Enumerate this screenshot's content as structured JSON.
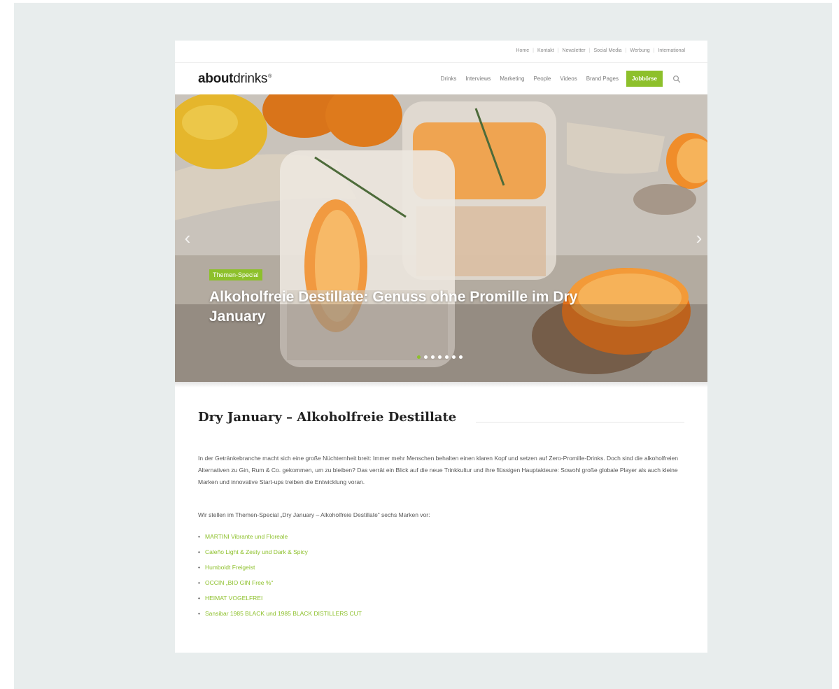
{
  "colors": {
    "accent": "#8dc02b",
    "page_bg": "#e8eded",
    "text": "#555555"
  },
  "toplinks": [
    "Home",
    "Kontakt",
    "Newsletter",
    "Social Media",
    "Werbung",
    "International"
  ],
  "logo": {
    "bold": "about",
    "light": "drinks",
    "mark": "®"
  },
  "nav": {
    "items": [
      "Drinks",
      "Interviews",
      "Marketing",
      "People",
      "Videos",
      "Brand Pages"
    ],
    "cta": "Jobbörse",
    "search_icon": "search-icon"
  },
  "hero": {
    "badge": "Themen-Special",
    "title": "Alkoholfreie Destillate: Genuss ohne Promille im Dry January",
    "slides": 7,
    "active_slide": 1
  },
  "article": {
    "heading": "Dry January – Alkoholfreie Destillate",
    "paragraph": "In der Getränkebranche macht sich eine große Nüchternheit breit: Immer mehr Menschen behalten einen klaren Kopf und setzen auf Zero-Promille-Drinks. Doch sind die alkoholfreien Alternativen zu Gin, Rum & Co. gekommen, um zu bleiben? Das verrät ein Blick auf die neue Trinkkultur und ihre flüssigen Hauptakteure: Sowohl große globale Player als auch kleine Marken und innovative Start-ups treiben die Entwicklung voran.",
    "intro": "Wir stellen im Themen-Special „Dry January – Alkoholfreie Destillate“ sechs Marken vor:",
    "links": [
      "MARTINI Vibrante und Floreale",
      "Caleño Light & Zesty und Dark & Spicy",
      "Humboldt Freigeist",
      "OCCIN „BIO GIN Free %“",
      "HEIMAT VOGELFREI",
      "Sansibar 1985 BLACK und 1985 BLACK DISTILLERS CUT"
    ]
  }
}
